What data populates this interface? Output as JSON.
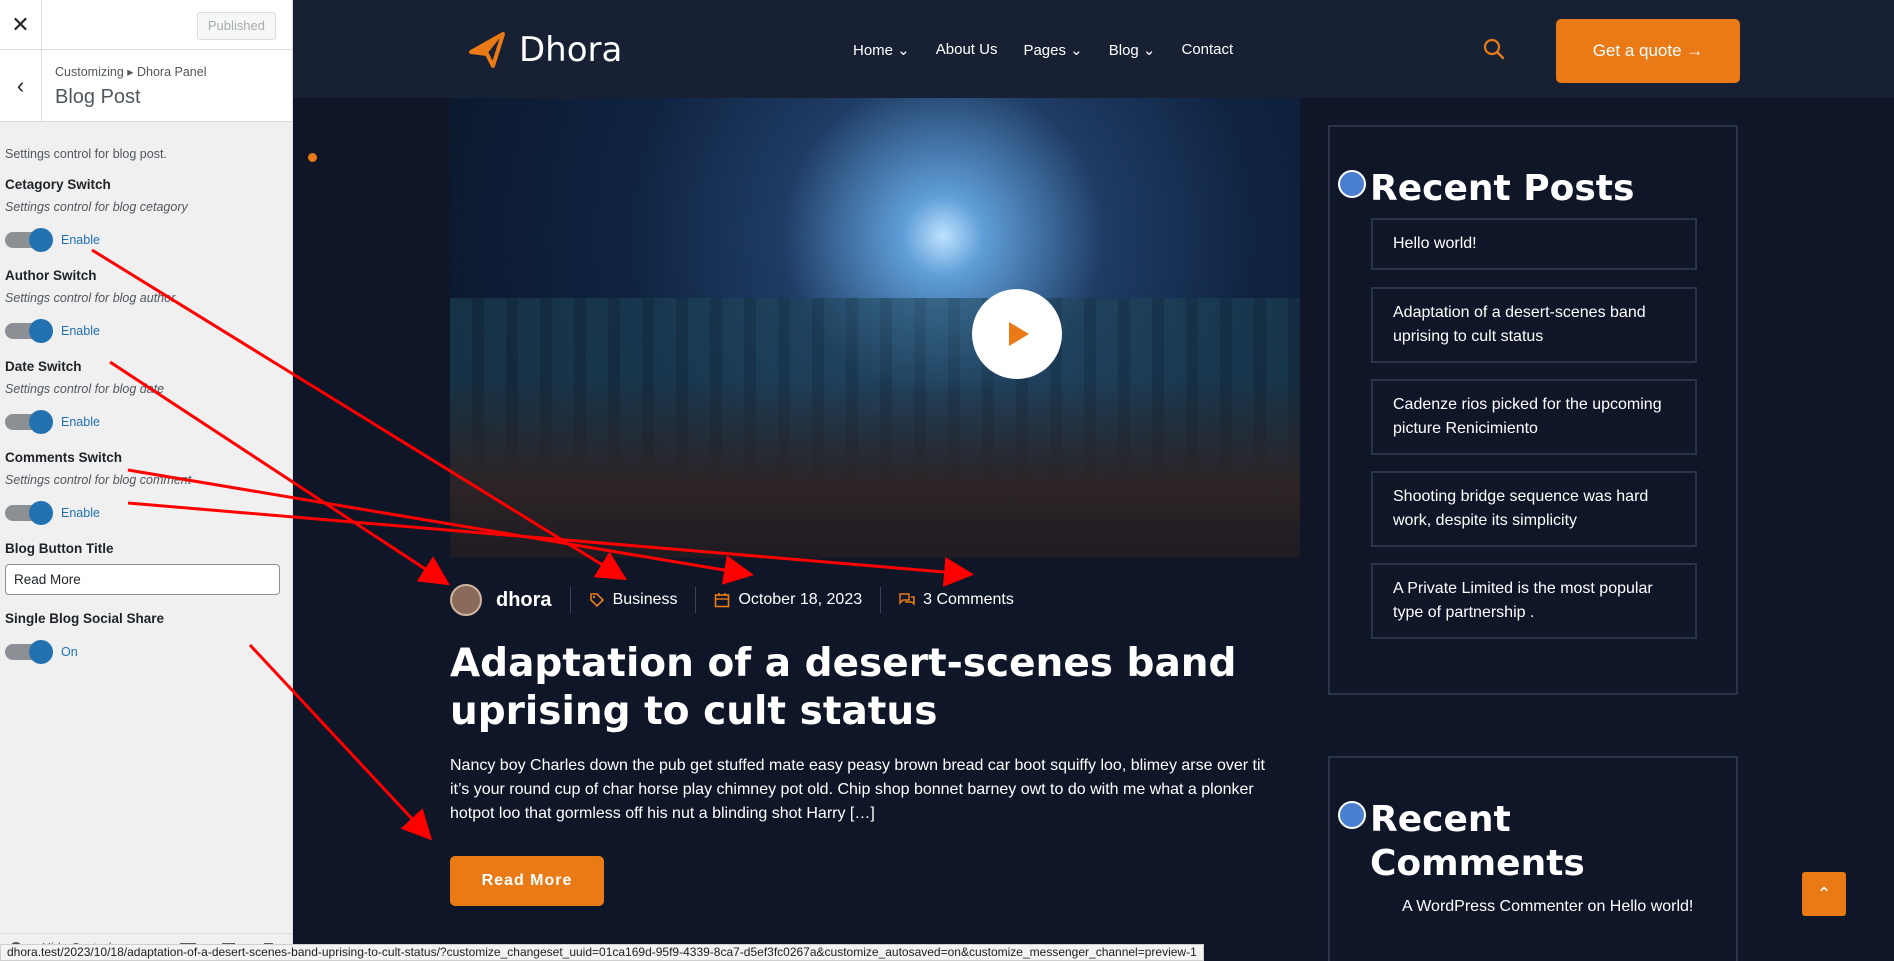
{
  "customizer": {
    "published_label": "Published",
    "breadcrumb": "Customizing ▸ Dhora Panel",
    "section_title": "Blog Post",
    "description": "Settings control for blog post.",
    "controls": [
      {
        "title": "Cetagory Switch",
        "desc": "Settings control for blog cetagory",
        "toggle": "Enable"
      },
      {
        "title": "Author Switch",
        "desc": "Settings control for blog author",
        "toggle": "Enable"
      },
      {
        "title": "Date Switch",
        "desc": "Settings control for blog date",
        "toggle": "Enable"
      },
      {
        "title": "Comments Switch",
        "desc": "Settings control for blog comment",
        "toggle": "Enable"
      }
    ],
    "button_title_label": "Blog Button Title",
    "button_title_value": "Read More",
    "social_share_label": "Single Blog Social Share",
    "social_share_toggle": "On",
    "hide_controls": "Hide Controls"
  },
  "site": {
    "logo": "Dhora",
    "nav": [
      "Home ⌄",
      "About Us",
      "Pages ⌄",
      "Blog ⌄",
      "Contact"
    ],
    "quote_button": "Get a quote →",
    "post": {
      "author": "dhora",
      "category": "Business",
      "date": "October 18, 2023",
      "comments": "3 Comments",
      "title": "Adaptation of a desert-scenes band uprising to cult status",
      "excerpt": "Nancy boy Charles down the pub get stuffed mate easy peasy brown bread car boot squiffy loo, blimey arse over tit it’s your round cup of char horse play chimney pot old. Chip shop bonnet barney owt to do with me what a plonker hotpot loo that gormless off his nut a blinding shot Harry […]",
      "read_more": "Read More"
    },
    "recent_posts_title": "Recent Posts",
    "recent_posts": [
      "Hello world!",
      "Adaptation of a desert-scenes band uprising to cult status",
      "Cadenze rios picked for the upcoming picture Renicimiento",
      "Shooting bridge sequence was hard work, despite its simplicity",
      "A Private Limited is the most popular type of partnership ."
    ],
    "recent_comments_title": "Recent Comments",
    "recent_comment": "A WordPress Commenter on Hello world!",
    "to_top": "⌃"
  },
  "status_url": "dhora.test/2023/10/18/adaptation-of-a-desert-scenes-band-uprising-to-cult-status/?customize_changeset_uuid=01ca169d-95f9-4339-8ca7-d5ef3fc0267a&customize_autosaved=on&customize_messenger_channel=preview-1",
  "colors": {
    "accent": "#e97a16",
    "bg": "#0f1628",
    "toggle": "#2271b1",
    "annotation": "#ff0000"
  }
}
